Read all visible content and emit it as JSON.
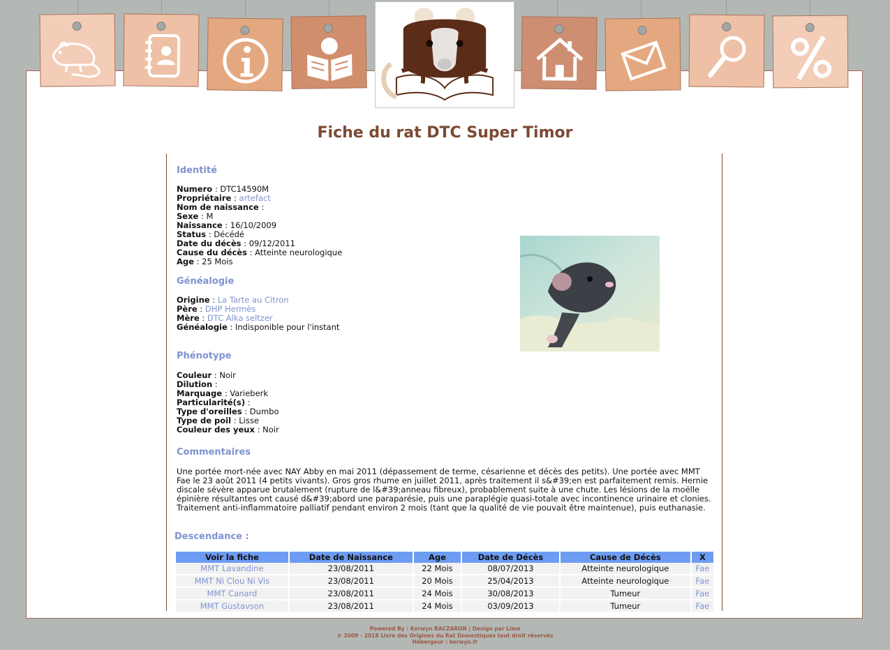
{
  "nav": {
    "items": [
      {
        "icon": "rat-icon",
        "label": "Rats"
      },
      {
        "icon": "contacts-icon",
        "label": "Contacts"
      },
      {
        "icon": "info-icon",
        "label": "Informations"
      },
      {
        "icon": "reader-icon",
        "label": "Lecture"
      },
      {
        "icon": "home-icon",
        "label": "Accueil"
      },
      {
        "icon": "mail-icon",
        "label": "Contact"
      },
      {
        "icon": "search-icon",
        "label": "Recherche"
      },
      {
        "icon": "percent-icon",
        "label": "Statistiques"
      }
    ],
    "colors": [
      "#f3cdb7",
      "#eec0a5",
      "#e4a880",
      "#d18e6c",
      "#cd8e71",
      "#e4a880",
      "#eec0a5",
      "#f3cdb7"
    ]
  },
  "page": {
    "title": "Fiche du rat DTC Super Timor"
  },
  "identite": {
    "heading": "Identité",
    "numero_label": "Numero",
    "numero": "DTC14590M",
    "proprietaire_label": "Propriétaire",
    "proprietaire": "artefact",
    "nom_naissance_label": "Nom de naissance",
    "nom_naissance": "",
    "sexe_label": "Sexe",
    "sexe": "M",
    "naissance_label": "Naissance",
    "naissance": "16/10/2009",
    "status_label": "Status",
    "status": "Décédé",
    "date_deces_label": "Date du décès",
    "date_deces": "09/12/2011",
    "cause_deces_label": "Cause du décès",
    "cause_deces": "Atteinte neurologique",
    "age_label": "Age",
    "age": "25 Mois"
  },
  "genealogie": {
    "heading": "Généalogie",
    "origine_label": "Origine",
    "origine": "La Tarte au Citron",
    "pere_label": "Père",
    "pere": "DHP Hermès",
    "mere_label": "Mère",
    "mere": "DTC Alka seltzer",
    "genealogie_label": "Généalogie",
    "genealogie": "Indisponible pour l'instant"
  },
  "phenotype": {
    "heading": "Phénotype",
    "couleur_label": "Couleur",
    "couleur": "Noir",
    "dilution_label": "Dilution",
    "dilution": "",
    "marquage_label": "Marquage",
    "marquage": "Varieberk",
    "particularites_label": "Particularité(s)",
    "particularites": "",
    "oreilles_label": "Type d'oreilles",
    "oreilles": "Dumbo",
    "poil_label": "Type de poil",
    "poil": "Lisse",
    "yeux_label": "Couleur des yeux",
    "yeux": "Noir"
  },
  "commentaires": {
    "heading": "Commentaires",
    "text": "Une portée mort-née avec NAY Abby en mai 2011 (dépassement de terme, césarienne et décès des petits). Une portée avec MMT Fae le 23 août 2011 (4 petits vivants). Gros gros rhume en juillet 2011, après traitement il s&#39;en est parfaitement remis. Hernie discale sévère apparue brutalement (rupture de l&#39;anneau fibreux), probablement suite à une chute. Les lésions de la moëlle épinière résultantes ont causé d&#39;abord une paraparésie, puis une paraplégie quasi-totale avec incontinence urinaire et clonies. Traitement anti-inflammatoire palliatif pendant environ 2 mois (tant que la qualité de vie pouvait être maintenue), puis euthanasie."
  },
  "descendance": {
    "heading": "Descendance :",
    "columns": [
      "Voir la fiche",
      "Date de Naissance",
      "Age",
      "Date de Décès",
      "Cause de Décès",
      "X"
    ],
    "rows": [
      [
        "MMT Lavandine",
        "23/08/2011",
        "22 Mois",
        "08/07/2013",
        "Atteinte neurologique",
        "Fae"
      ],
      [
        "MMT Ni Clou Ni Vis",
        "23/08/2011",
        "20 Mois",
        "25/04/2013",
        "Atteinte neurologique",
        "Fae"
      ],
      [
        "MMT Canard",
        "23/08/2011",
        "24 Mois",
        "30/08/2013",
        "Tumeur",
        "Fae"
      ],
      [
        "MMT Gustavson",
        "23/08/2011",
        "24 Mois",
        "03/09/2013",
        "Tumeur",
        "Fae"
      ]
    ]
  },
  "footer": {
    "line1": "Powered By : Kerwyn RACZARON | Design par Lime",
    "line2": "© 2009 - 2018 Livre des Origines du Rat Domestiques tout droit réservés",
    "line3": "Hébergeur : kerwyn.fr"
  },
  "colors": {
    "background": "#b3b8b5",
    "title": "#7b4a33",
    "section_heading": "#7f93cf",
    "table_header": "#6d9cf2",
    "link": "#7f93cf"
  }
}
